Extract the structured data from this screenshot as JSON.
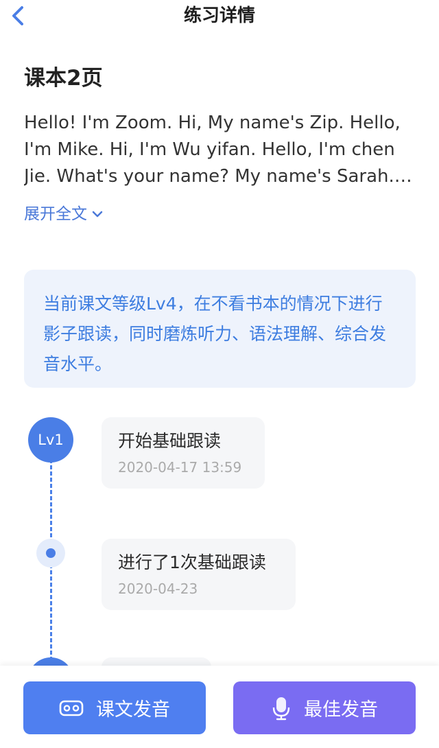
{
  "header": {
    "title": "练习详情",
    "back_icon": "chevron-left-icon"
  },
  "lesson": {
    "title": "课本2页",
    "text": "Hello! I'm Zoom. Hi, My name's Zip. Hello, I'm Mike. Hi, I'm Wu yifan. Hello, I'm chen Jie. What's your name? My name's Sarah. Good...",
    "expand_label": "展开全文",
    "expand_icon": "chevron-down-icon"
  },
  "info": {
    "text": "当前课文等级Lv4，在不看书本的情况下进行影子跟读，同时磨炼听力、语法理解、综合发音水平。"
  },
  "timeline": [
    {
      "badge": "Lv1",
      "title": "开始基础跟读",
      "date": "2020-04-17 13:59"
    },
    {
      "badge": "",
      "title": "进行了1次基础跟读",
      "date": "2020-04-23"
    }
  ],
  "bottom": {
    "left_label": "课文发音",
    "left_icon": "vr-headset-icon",
    "right_label": "最佳发音",
    "right_icon": "microphone-icon"
  },
  "colors": {
    "accent": "#4a7ee6",
    "info_bg": "#eef3fc",
    "info_text": "#3d7de0",
    "btn_left": "#4f7ff0",
    "btn_right": "#7a6cf2"
  }
}
